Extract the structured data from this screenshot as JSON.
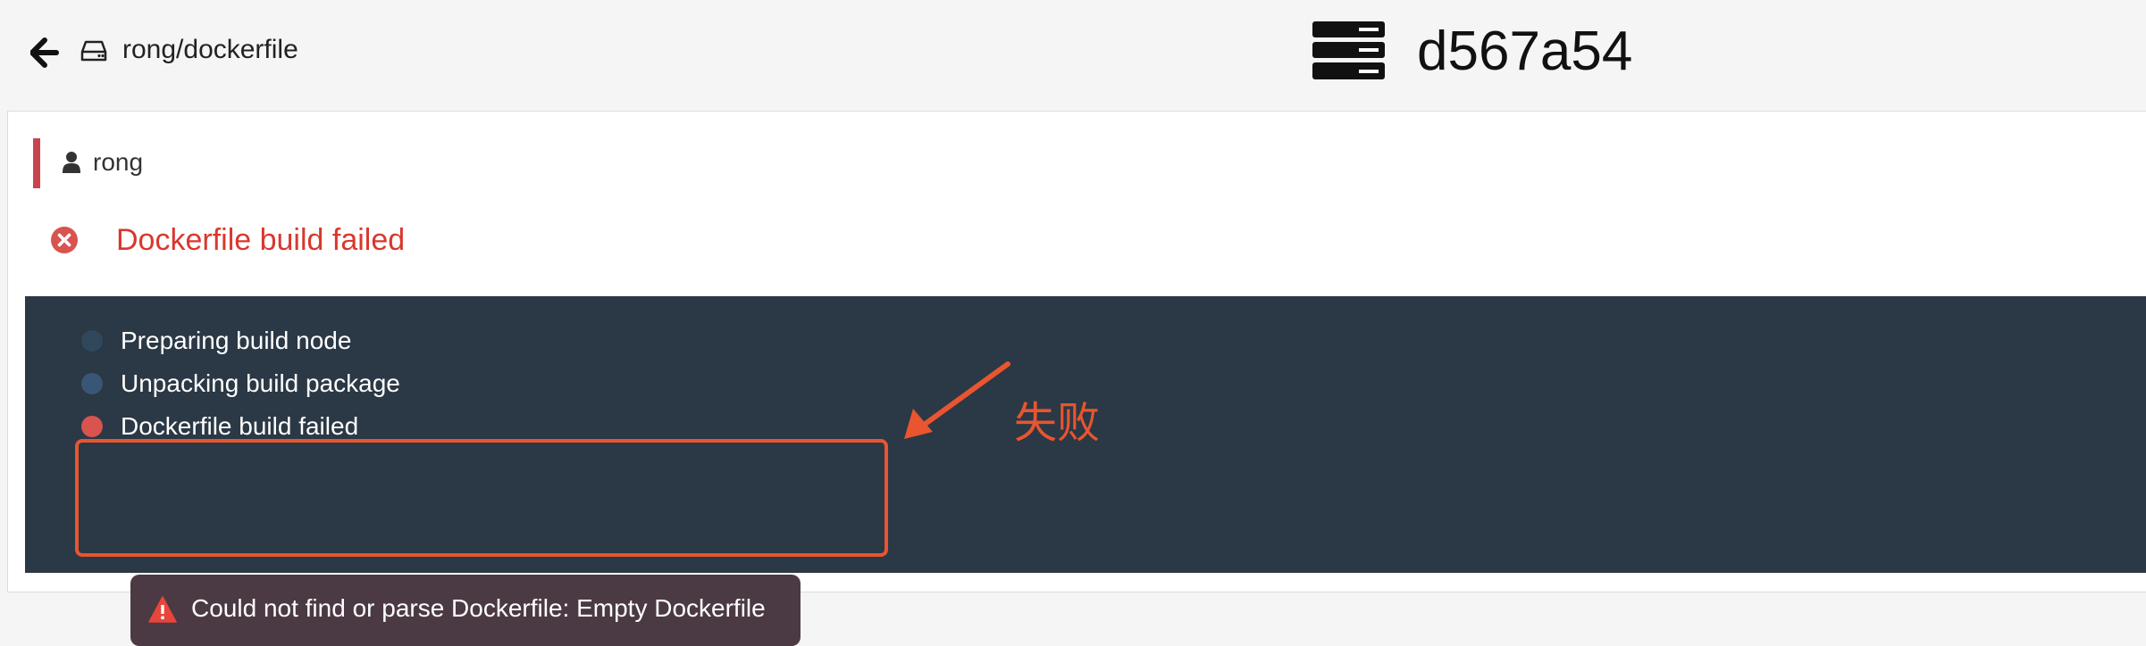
{
  "header": {
    "back_icon": "arrow-left-icon",
    "repo_icon": "hard-drive-icon",
    "repo_name": "rong/dockerfile",
    "build_icon": "server-icon",
    "build_id": "d567a54"
  },
  "build": {
    "user_icon": "user-icon",
    "user_name": "rong",
    "status_icon": "error-circle-icon",
    "status_text": "Dockerfile build failed",
    "steps": [
      {
        "label": "Preparing build node",
        "state": "done",
        "color": "#31475c"
      },
      {
        "label": "Unpacking build package",
        "state": "done",
        "color": "#3a5677"
      },
      {
        "label": "Dockerfile build failed",
        "state": "error",
        "color": "#d9534f"
      }
    ],
    "error": {
      "icon": "warning-triangle-icon",
      "message": "Could not find or parse Dockerfile: Empty Dockerfile"
    }
  },
  "annotation": {
    "label": "失败",
    "color": "#e8552f"
  },
  "colors": {
    "accent_red": "#d8382e",
    "log_background": "#2b3845",
    "user_bar": "#c9444e"
  }
}
